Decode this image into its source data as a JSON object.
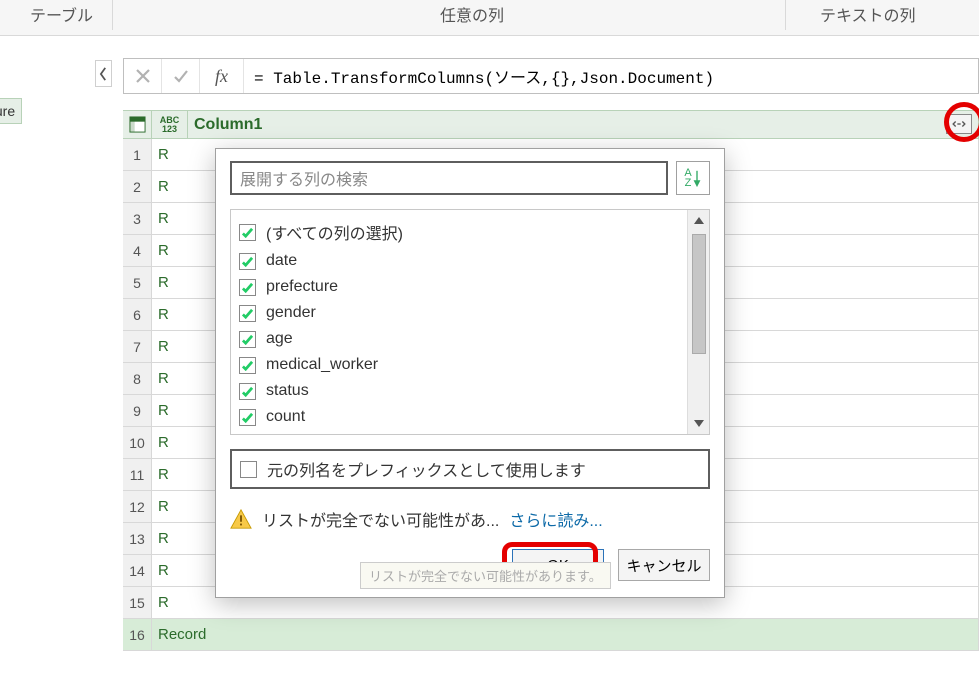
{
  "ribbon": {
    "group_table": "テーブル",
    "group_any_column": "任意の列",
    "group_text_column": "テキストの列"
  },
  "sidebar": {
    "fragment": "ture"
  },
  "formula_bar": {
    "text": "= Table.TransformColumns(ソース,{},Json.Document)"
  },
  "grid": {
    "column_type_top": "ABC",
    "column_type_bottom": "123",
    "column_name": "Column1",
    "rows": [
      {
        "n": "1",
        "v": "R"
      },
      {
        "n": "2",
        "v": "R"
      },
      {
        "n": "3",
        "v": "R"
      },
      {
        "n": "4",
        "v": "R"
      },
      {
        "n": "5",
        "v": "R"
      },
      {
        "n": "6",
        "v": "R"
      },
      {
        "n": "7",
        "v": "R"
      },
      {
        "n": "8",
        "v": "R"
      },
      {
        "n": "9",
        "v": "R"
      },
      {
        "n": "10",
        "v": "R"
      },
      {
        "n": "11",
        "v": "R"
      },
      {
        "n": "12",
        "v": "R"
      },
      {
        "n": "13",
        "v": "R"
      },
      {
        "n": "14",
        "v": "R"
      },
      {
        "n": "15",
        "v": "R"
      },
      {
        "n": "16",
        "v": "Record"
      }
    ]
  },
  "popup": {
    "search_placeholder": "展開する列の検索",
    "sort_az_top": "A",
    "sort_az_bottom": "Z",
    "select_all": "(すべての列の選択)",
    "columns": [
      {
        "label": "date"
      },
      {
        "label": "prefecture"
      },
      {
        "label": "gender"
      },
      {
        "label": "age"
      },
      {
        "label": "medical_worker"
      },
      {
        "label": "status"
      },
      {
        "label": "count"
      }
    ],
    "prefix_label": "元の列名をプレフィックスとして使用します",
    "warn_text": "リストが完全でない可能性があ...",
    "warn_link": "さらに読み...",
    "tooltip_ghost": "リストが完全でない可能性があります。",
    "ok": "OK",
    "cancel": "キャンセル"
  }
}
